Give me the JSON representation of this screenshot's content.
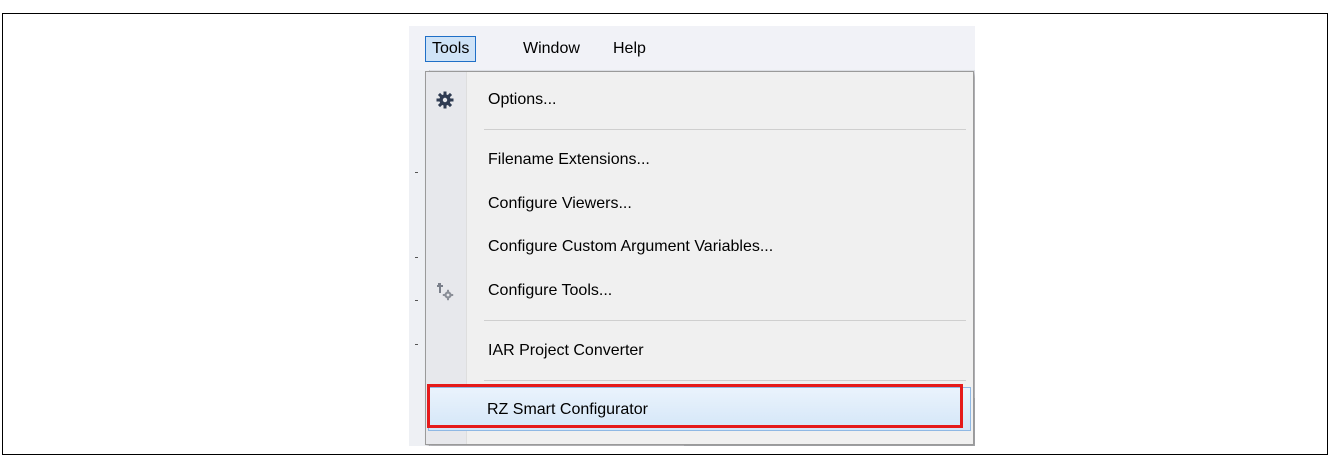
{
  "caption_partial": "Tools menu showing RZ Smart Configurator",
  "menubar": {
    "items": [
      {
        "label": "Tools",
        "active": true
      },
      {
        "label": "Window",
        "active": false
      },
      {
        "label": "Help",
        "active": false
      }
    ]
  },
  "tools_menu": {
    "items": [
      {
        "label": "Options...",
        "icon": "gear-icon"
      },
      {
        "label": "Filename Extensions...",
        "icon": ""
      },
      {
        "label": "Configure Viewers...",
        "icon": ""
      },
      {
        "label": "Configure Custom Argument Variables...",
        "icon": ""
      },
      {
        "label": "Configure Tools...",
        "icon": "tools-wrench-gear-icon"
      },
      {
        "label": "IAR Project Converter",
        "icon": ""
      },
      {
        "label": "RZ Smart Configurator",
        "icon": "",
        "highlighted": true
      }
    ]
  },
  "colors": {
    "highlight_border": "#e51a1a",
    "hover_border": "#8fb8e4",
    "active_menubar_border": "#1f6fc7"
  }
}
